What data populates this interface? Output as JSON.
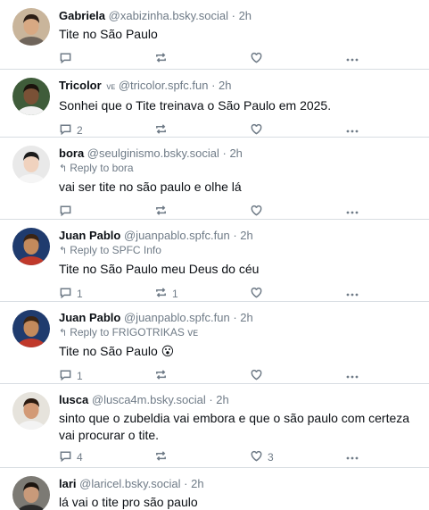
{
  "posts": [
    {
      "author": "Gabriela",
      "handle": "@xabizinha.bsky.social",
      "time": "· 2h",
      "badge": "",
      "reply_to": "",
      "text": "Tite no São Paulo",
      "reply_count": "",
      "repost_count": "",
      "like_count": "",
      "avatar_colors": {
        "bg": "#c9b59b",
        "skin": "#d8a983",
        "hair": "#2b1d14",
        "shirt": "#6f655b"
      }
    },
    {
      "author": "Tricolor",
      "badge": "ᴠᴇ",
      "handle": "@tricolor.spfc.fun",
      "time": "· 2h",
      "reply_to": "",
      "text": "Sonhei que o Tite treinava o São Paulo em 2025.",
      "reply_count": "2",
      "repost_count": "",
      "like_count": "",
      "avatar_colors": {
        "bg": "#3f5c3a",
        "skin": "#7a5136",
        "hair": "#1a120c",
        "shirt": "#f2f2f2"
      }
    },
    {
      "author": "bora",
      "badge": "",
      "handle": "@seulginismo.bsky.social",
      "time": "· 2h",
      "reply_to": "Reply to bora",
      "text": "vai ser tite no são paulo e olhe lá",
      "reply_count": "",
      "repost_count": "",
      "like_count": "",
      "avatar_colors": {
        "bg": "#e9e9e9",
        "skin": "#f0d2be",
        "hair": "#1b1b1b",
        "shirt": "#f5f5f5"
      }
    },
    {
      "author": "Juan Pablo",
      "badge": "",
      "handle": "@juanpablo.spfc.fun",
      "time": "· 2h",
      "reply_to": "Reply to SPFC Info",
      "text": "Tite no São Paulo meu Deus do céu",
      "reply_count": "1",
      "repost_count": "1",
      "like_count": "",
      "avatar_colors": {
        "bg": "#1f3b6e",
        "skin": "#c48a5c",
        "hair": "#3a2414",
        "shirt": "#c0392b"
      }
    },
    {
      "author": "Juan Pablo",
      "badge": "",
      "handle": "@juanpablo.spfc.fun",
      "time": "· 2h",
      "reply_to": "Reply to FRIGOTRIKAS ᴠᴇ",
      "text": "Tite no São Paulo 😮",
      "reply_count": "1",
      "repost_count": "",
      "like_count": "",
      "avatar_colors": {
        "bg": "#1f3b6e",
        "skin": "#c48a5c",
        "hair": "#3a2414",
        "shirt": "#c0392b"
      }
    },
    {
      "author": "lusca",
      "badge": "",
      "handle": "@lusca4m.bsky.social",
      "time": "· 2h",
      "reply_to": "",
      "text": "sinto que o zubeldia vai embora e que o são paulo com certeza vai procurar o tite.",
      "reply_count": "4",
      "repost_count": "",
      "like_count": "3",
      "avatar_colors": {
        "bg": "#e6e3dc",
        "skin": "#d29a76",
        "hair": "#2a1a10",
        "shirt": "#f3f3f3"
      }
    },
    {
      "author": "lari",
      "badge": "",
      "handle": "@laricel.bsky.social",
      "time": "· 2h",
      "reply_to": "",
      "text": "lá vai o tite pro são paulo",
      "reply_count": "",
      "repost_count": "",
      "like_count": "",
      "avatar_colors": {
        "bg": "#7c7a74",
        "skin": "#c89a7a",
        "hair": "#1b140f",
        "shirt": "#2b2b2b"
      }
    }
  ],
  "icons": {
    "reply": "reply-icon",
    "repost": "repost-icon",
    "like": "heart-icon",
    "more": "more-icon",
    "reply_arrow": "reply-arrow-icon"
  },
  "colors": {
    "muted": "#6f7b87",
    "divider": "#d8dde2",
    "text": "#0b0f14"
  }
}
